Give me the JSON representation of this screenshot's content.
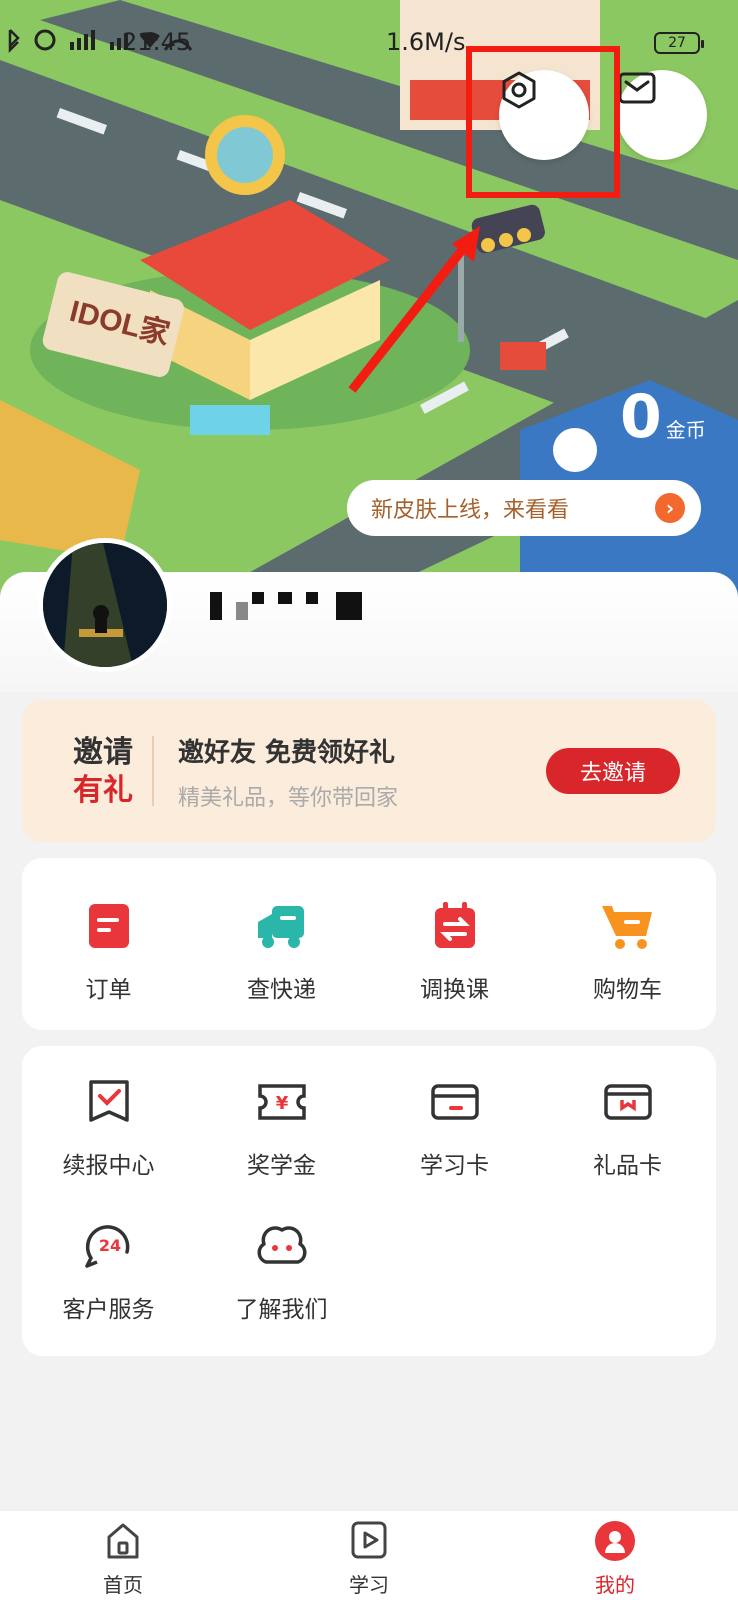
{
  "status_bar": {
    "time": "21:45",
    "network_speed": "1.6M/s",
    "battery": "27"
  },
  "header": {
    "coins_value": "0",
    "coins_unit": "金币",
    "skin_banner": "新皮肤上线，来看看",
    "illustration_sign": "IDOL家"
  },
  "invite": {
    "tag_line1": "邀请",
    "tag_line2": "有礼",
    "title": "邀好友 免费领好礼",
    "subtitle": "精美礼品，等你带回家",
    "button": "去邀请"
  },
  "quick_actions": [
    {
      "label": "订单",
      "icon": "order-icon"
    },
    {
      "label": "查快递",
      "icon": "delivery-truck-icon"
    },
    {
      "label": "调换课",
      "icon": "swap-course-icon"
    },
    {
      "label": "购物车",
      "icon": "shopping-cart-icon"
    }
  ],
  "services": [
    {
      "label": "续报中心",
      "icon": "renewal-icon"
    },
    {
      "label": "奖学金",
      "icon": "scholarship-ticket-icon"
    },
    {
      "label": "学习卡",
      "icon": "study-card-icon"
    },
    {
      "label": "礼品卡",
      "icon": "gift-card-icon"
    },
    {
      "label": "客户服务",
      "icon": "customer-service-24-icon"
    },
    {
      "label": "了解我们",
      "icon": "about-us-cloud-icon"
    }
  ],
  "bottom_nav": [
    {
      "label": "首页",
      "icon": "home-icon",
      "active": false
    },
    {
      "label": "学习",
      "icon": "play-icon",
      "active": false
    },
    {
      "label": "我的",
      "icon": "mine-icon",
      "active": true
    }
  ],
  "colors": {
    "accent_red": "#d8262b",
    "highlight_red": "#f21d10",
    "invite_bg": "#fbecdc",
    "banner_text": "#a5612b"
  }
}
